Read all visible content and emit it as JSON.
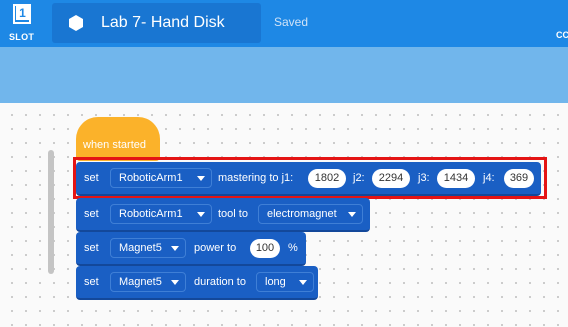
{
  "topbar": {
    "slot_number": "1",
    "slot_label": "SLOT",
    "project_title": "Lab 7- Hand Disk",
    "status": "Saved",
    "right_cut_text": "CC"
  },
  "blocks": {
    "hat": {
      "label": "when started"
    },
    "mastering": {
      "verb": "set",
      "device": "RoboticArm1",
      "text": "mastering to j1:",
      "j1": "1802",
      "j2_label": "j2:",
      "j2": "2294",
      "j3_label": "j3:",
      "j3": "1434",
      "j4_label": "j4:",
      "j4": "369"
    },
    "tool": {
      "verb": "set",
      "device": "RoboticArm1",
      "text": "tool to",
      "tool": "electromagnet"
    },
    "power": {
      "verb": "set",
      "device": "Magnet5",
      "text": "power to",
      "value": "100",
      "unit": "%"
    },
    "duration": {
      "verb": "set",
      "device": "Magnet5",
      "text": "duration to",
      "value": "long"
    }
  },
  "colors": {
    "topbar": "#1e88e5",
    "strip": "#71b6ec",
    "block": "#1a5fc4",
    "hat": "#fbb22a",
    "highlight": "#e41414"
  }
}
